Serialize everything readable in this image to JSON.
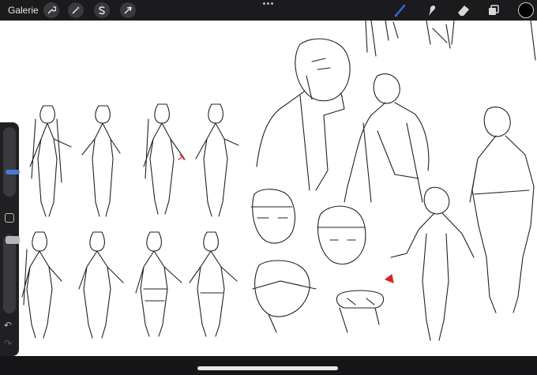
{
  "topbar": {
    "gallery_label": "Galerie",
    "left_tools": [
      {
        "name": "actions",
        "icon": "wrench-icon"
      },
      {
        "name": "adjustments",
        "icon": "magic-wand-icon"
      },
      {
        "name": "selection",
        "icon": "selection-s-icon"
      },
      {
        "name": "transform",
        "icon": "arrow-cursor-icon"
      }
    ],
    "right_tools": [
      {
        "name": "brush",
        "icon": "brush-icon",
        "active": true
      },
      {
        "name": "smudge",
        "icon": "smudge-icon"
      },
      {
        "name": "eraser",
        "icon": "eraser-icon"
      },
      {
        "name": "layers",
        "icon": "layers-icon"
      }
    ],
    "current_color": "#000000",
    "active_color": "#2f6be3"
  },
  "sidebar": {
    "brush_size_icon": "size-slider-knob",
    "opacity_icon": "opacity-slider-knob",
    "modify_icon": "square-modify-icon",
    "undo_label": "↶",
    "redo_label": "↷"
  },
  "canvas": {
    "description_icon": "sketch-sheet"
  }
}
